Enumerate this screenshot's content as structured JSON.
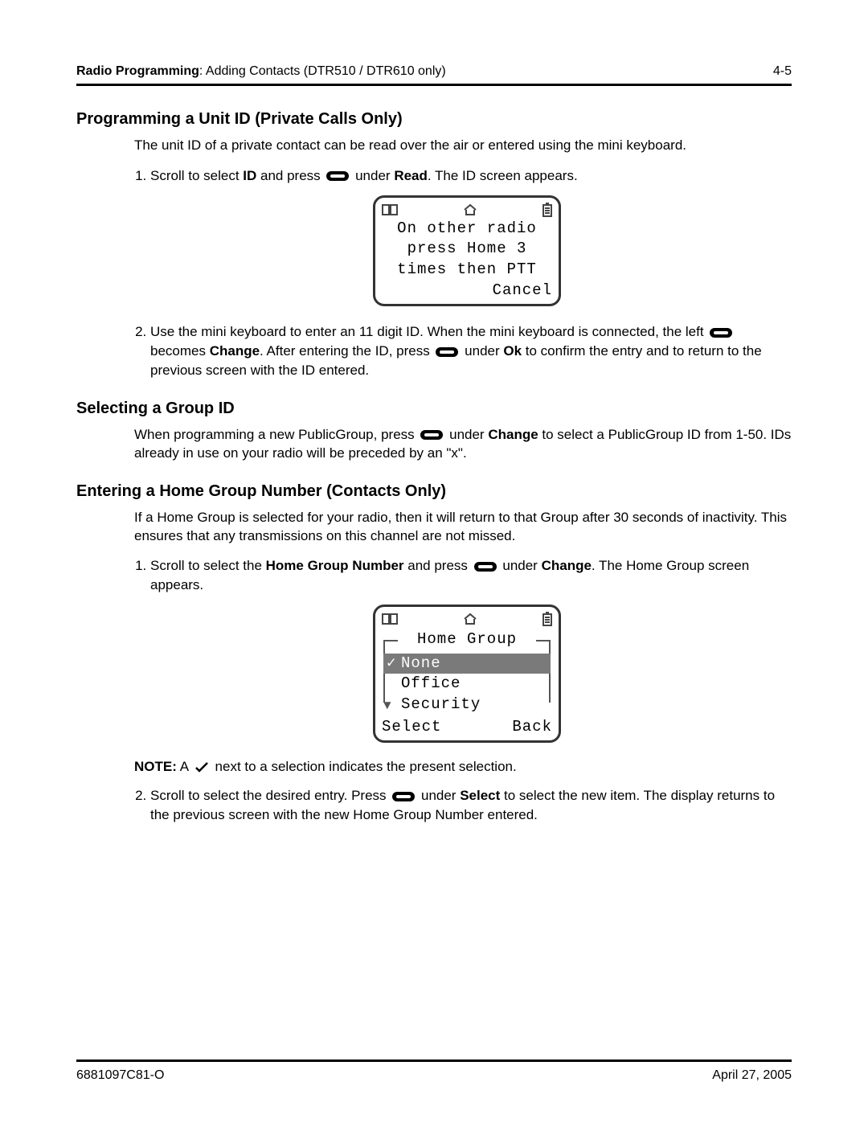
{
  "header": {
    "section_bold": "Radio Programming",
    "section_rest": ": Adding Contacts (DTR510 / DTR610 only)",
    "page_num": "4-5"
  },
  "s1": {
    "title": "Programming a Unit ID (Private Calls Only)",
    "intro": "The unit ID of a private contact can be read over the air or entered using the mini keyboard.",
    "step1_a": "Scroll to select ",
    "step1_id": "ID",
    "step1_b": " and press ",
    "step1_c": " under ",
    "step1_read": "Read",
    "step1_d": ". The ID screen appears.",
    "lcd": {
      "l1": "On other radio",
      "l2": "press Home 3",
      "l3": "times then PTT",
      "cancel": "Cancel"
    },
    "step2_a": "Use the mini keyboard to enter an 11 digit ID. When the mini keyboard is connected, the left ",
    "step2_b": " becomes ",
    "step2_change": "Change",
    "step2_c": ". After entering the ID, press ",
    "step2_d": " under ",
    "step2_ok": "Ok",
    "step2_e": " to confirm the entry and to return to the previous screen with the ID entered."
  },
  "s2": {
    "title": "Selecting a Group ID",
    "p_a": "When programming a new PublicGroup, press ",
    "p_b": " under ",
    "p_change": "Change",
    "p_c": " to select a PublicGroup ID from 1-50. IDs already in use on your radio will be preceded by an \"x\"."
  },
  "s3": {
    "title": "Entering a Home Group Number (Contacts Only)",
    "intro": "If a Home Group is selected for your radio, then it will return to that Group after 30 seconds of inactivity. This ensures that any transmissions on this channel are not missed.",
    "step1_a": "Scroll to select the ",
    "step1_hgn": "Home Group Number",
    "step1_b": " and press ",
    "step1_c": " under ",
    "step1_change": "Change",
    "step1_d": ". The Home Group screen appears.",
    "lcd": {
      "title": "Home Group",
      "items": [
        "None",
        "Office",
        "Security"
      ],
      "select": "Select",
      "back": "Back"
    },
    "note_a": "NOTE:",
    "note_b": "A ",
    "note_c": " next to a selection indicates the present selection.",
    "step2_a": "Scroll to select the desired entry. Press ",
    "step2_b": " under ",
    "step2_select": "Select",
    "step2_c": " to select the new item. The display returns to the previous screen with the new Home Group Number entered."
  },
  "footer": {
    "left": "6881097C81-O",
    "right": "April 27, 2005"
  }
}
